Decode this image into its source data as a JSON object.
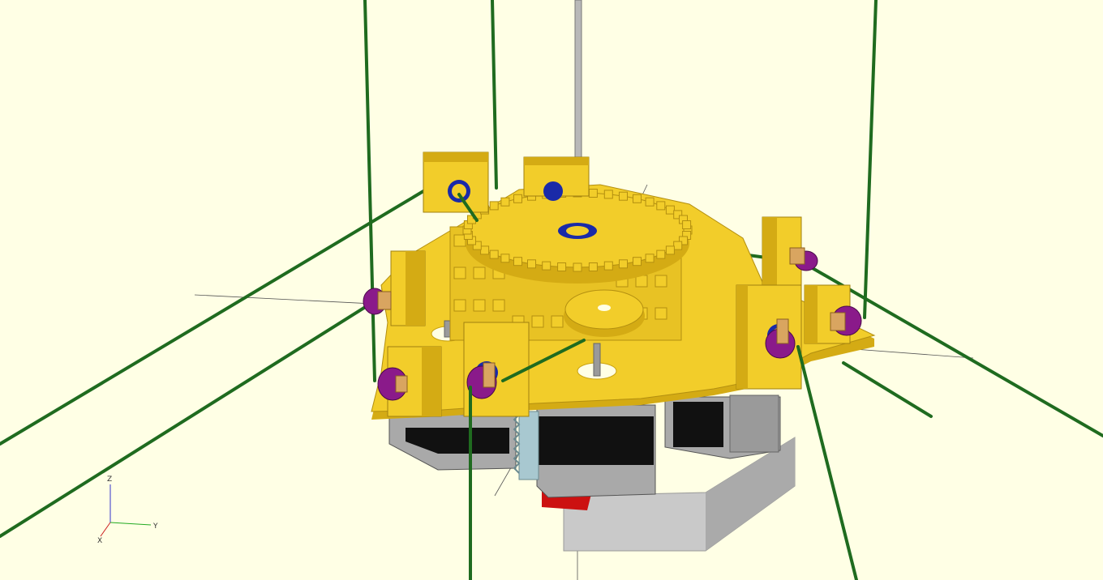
{
  "viewport": {
    "background": "#ffffe5",
    "model_colors": {
      "body": "#f2cd2a",
      "body_dark": "#d4ab14",
      "rod": "#1f6b1f",
      "motor_black": "#111111",
      "motor_gray": "#a9a9a9",
      "base_gray": "#c6c6c6",
      "bearing_purple": "#8a1a8a",
      "hole_blue": "#1a2aa8",
      "spindle": "#b8b8b8"
    }
  },
  "axis_gizmo": {
    "z_label": "Z",
    "y_label": "Y",
    "x_label": "X"
  }
}
